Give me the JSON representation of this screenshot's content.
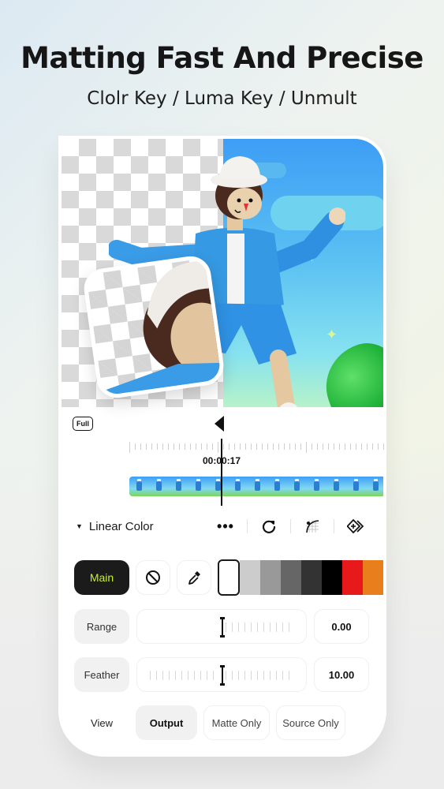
{
  "promo": {
    "headline": "Matting Fast And Precise",
    "subheadline": "Clolr Key / Luma Key / Unmult"
  },
  "preview": {
    "description": "3D cartoon character with transparent checkerboard left half and sky background right half",
    "inset_description": "Zoomed cut-out of character head on transparent background"
  },
  "player": {
    "full_label": "Full",
    "play_icon": "play-icon",
    "timecode": "00:00:17"
  },
  "toolbar": {
    "mode_label": "Linear Color",
    "icons": [
      "more-icon",
      "reset-icon",
      "curve-grid-icon",
      "keyframe-add-icon"
    ]
  },
  "color_picker": {
    "main_label": "Main",
    "none_icon": "no-color-icon",
    "eyedropper_icon": "eyedropper-icon",
    "selected_swatch": "#ffffff",
    "swatches": [
      "#cccccc",
      "#999999",
      "#666666",
      "#333333",
      "#000000",
      "#e8191b",
      "#e87e1c"
    ],
    "accent_color": "#c6f02c"
  },
  "params": [
    {
      "label": "Range",
      "value": "0.00",
      "position": 0.5
    },
    {
      "label": "Feather",
      "value": "10.00",
      "position": 0.5
    }
  ],
  "view": {
    "label": "View",
    "options": [
      {
        "label": "Output",
        "active": true
      },
      {
        "label": "Matte Only",
        "active": false
      },
      {
        "label": "Source Only",
        "active": false
      }
    ]
  }
}
